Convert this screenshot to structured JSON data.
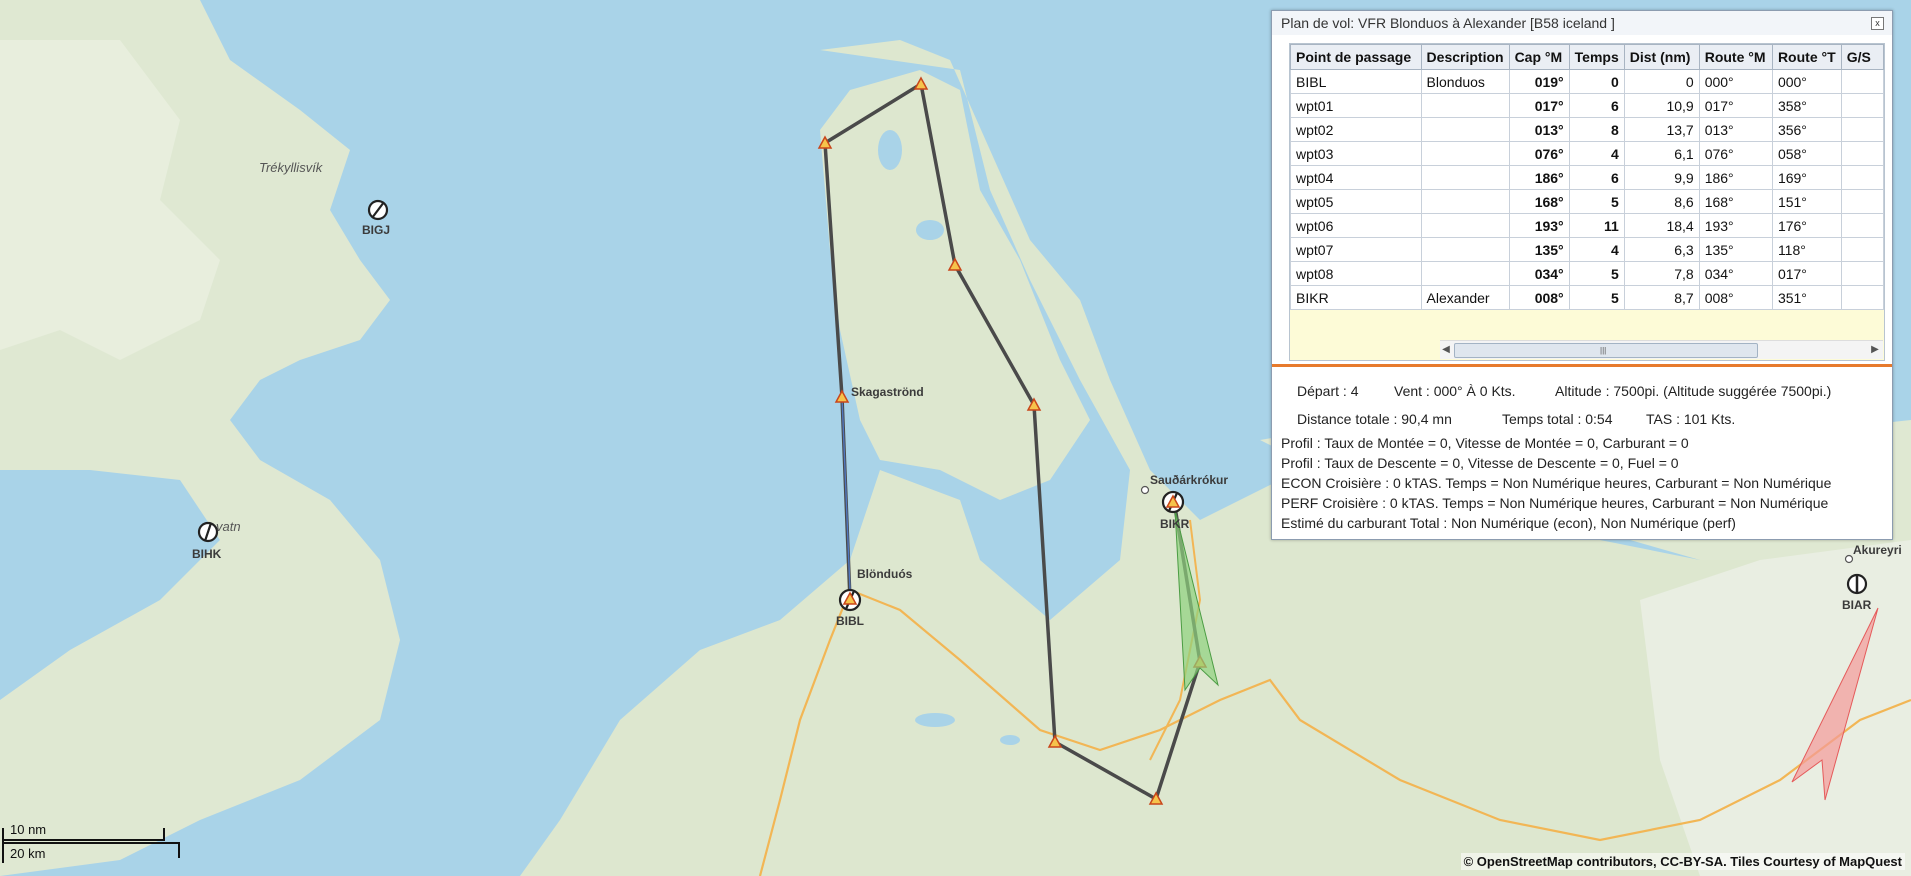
{
  "map": {
    "place_labels": {
      "trekyllisvik": "Trékyllisvík",
      "skagastrond": "Skagaströnd",
      "blonduos": "Blönduós",
      "saudarkrokur": "Sauðárkrókur",
      "akureyri": "Akureyri",
      "vatn": "vatn"
    },
    "airports": {
      "bigj": "BIGJ",
      "bihk": "BIHK",
      "bibl": "BIBL",
      "bikr": "BIKR",
      "biar": "BIAR"
    },
    "scale": {
      "nm": "10 nm",
      "km": "20 km"
    },
    "attribution": "© OpenStreetMap contributors, CC-BY-SA. Tiles Courtesy of MapQuest"
  },
  "panel": {
    "title": "Plan de vol: VFR Blonduos à Alexander [B58 iceland ]",
    "close": "x",
    "columns": [
      "Point de passage",
      "Description",
      "Cap °M",
      "Temps",
      "Dist (nm)",
      "Route °M",
      "Route °T",
      "G/S"
    ],
    "rows": [
      {
        "wp": "BIBL",
        "desc": "Blonduos",
        "cap": "019°",
        "temps": "0",
        "dist": "0",
        "rm": "000°",
        "rt": "000°"
      },
      {
        "wp": "wpt01",
        "desc": "",
        "cap": "017°",
        "temps": "6",
        "dist": "10,9",
        "rm": "017°",
        "rt": "358°"
      },
      {
        "wp": "wpt02",
        "desc": "",
        "cap": "013°",
        "temps": "8",
        "dist": "13,7",
        "rm": "013°",
        "rt": "356°"
      },
      {
        "wp": "wpt03",
        "desc": "",
        "cap": "076°",
        "temps": "4",
        "dist": "6,1",
        "rm": "076°",
        "rt": "058°"
      },
      {
        "wp": "wpt04",
        "desc": "",
        "cap": "186°",
        "temps": "6",
        "dist": "9,9",
        "rm": "186°",
        "rt": "169°"
      },
      {
        "wp": "wpt05",
        "desc": "",
        "cap": "168°",
        "temps": "5",
        "dist": "8,6",
        "rm": "168°",
        "rt": "151°"
      },
      {
        "wp": "wpt06",
        "desc": "",
        "cap": "193°",
        "temps": "11",
        "dist": "18,4",
        "rm": "193°",
        "rt": "176°"
      },
      {
        "wp": "wpt07",
        "desc": "",
        "cap": "135°",
        "temps": "4",
        "dist": "6,3",
        "rm": "135°",
        "rt": "118°"
      },
      {
        "wp": "wpt08",
        "desc": "",
        "cap": "034°",
        "temps": "5",
        "dist": "7,8",
        "rm": "034°",
        "rt": "017°"
      },
      {
        "wp": "BIKR",
        "desc": "Alexander",
        "cap": "008°",
        "temps": "5",
        "dist": "8,7",
        "rm": "008°",
        "rt": "351°"
      }
    ],
    "summary": {
      "depart": "Départ :  4",
      "vent": "Vent :  000° À 0 Kts.",
      "altitude": "Altitude :  7500pi. (Altitude suggérée 7500pi.)",
      "distance": "Distance totale :  90,4 mn",
      "temps": "Temps total :  0:54",
      "tas": "TAS :  101 Kts.",
      "lines": [
        "Profil : Taux de Montée = 0, Vitesse de Montée = 0, Carburant = 0",
        "Profil : Taux de Descente = 0, Vitesse de Descente = 0, Fuel = 0",
        "ECON Croisière : 0 kTAS. Temps = Non Numérique heures, Carburant = Non Numérique",
        "PERF Croisière : 0 kTAS. Temps = Non Numérique heures, Carburant = Non Numérique",
        "Estimé du carburant Total : Non Numérique (econ), Non Numérique (perf)"
      ]
    }
  }
}
